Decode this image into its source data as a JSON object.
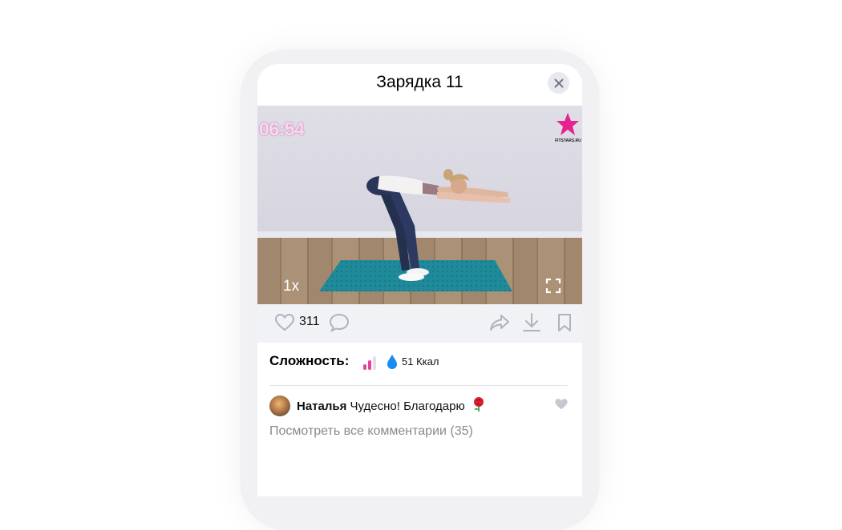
{
  "modal": {
    "title": "Зарядка 11"
  },
  "video": {
    "timer": "06:54",
    "logo_text": "FITSTARS.RU",
    "speed": "1x"
  },
  "actions": {
    "likes_count": "311"
  },
  "info": {
    "difficulty_label": "Сложность:",
    "difficulty_level": 2,
    "difficulty_max": 3,
    "calories": "51 Ккал"
  },
  "comment": {
    "author": "Наталья",
    "text": "Чудесно! Благодарю"
  },
  "comments_link": "Посмотреть все комментарии (35)",
  "colors": {
    "accent": "#e8409d",
    "drop": "#1a8cf0",
    "icon_gray": "#b0b3bd"
  }
}
